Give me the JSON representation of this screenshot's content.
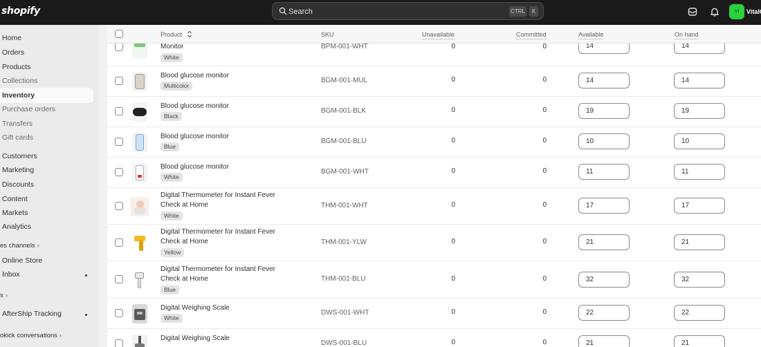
{
  "topbar": {
    "logo": "shopify",
    "search_placeholder": "Search",
    "shortcut_ctrl": "CTRL",
    "shortcut_k": "K",
    "avatar_initials": "VI",
    "store_name": "VitalC"
  },
  "sidebar": {
    "items": [
      {
        "label": "Home"
      },
      {
        "label": "Orders"
      },
      {
        "label": "Products"
      },
      {
        "label": "Collections"
      },
      {
        "label": "Inventory"
      },
      {
        "label": "Purchase orders"
      },
      {
        "label": "Transfers"
      },
      {
        "label": "Gift cards"
      },
      {
        "label": "Customers"
      },
      {
        "label": "Marketing"
      },
      {
        "label": "Discounts"
      },
      {
        "label": "Content"
      },
      {
        "label": "Markets"
      },
      {
        "label": "Analytics"
      },
      {
        "label": "es channels"
      },
      {
        "label": "Online Store"
      },
      {
        "label": "Inbox"
      },
      {
        "label": "s"
      },
      {
        "label": "AfterShip Tracking"
      },
      {
        "label": "okick conversations"
      }
    ]
  },
  "table": {
    "columns": {
      "product": "Product",
      "sku": "SKU",
      "unavailable": "Unavailable",
      "committed": "Committed",
      "available": "Available",
      "on_hand": "On hand"
    },
    "rows": [
      {
        "name": "Monitor",
        "variant": "White",
        "sku": "BPM-001-WHT",
        "unavailable": "0",
        "committed": "0",
        "available": "14",
        "on_hand": "14"
      },
      {
        "name": "Blood glucose monitor",
        "variant": "Multicolor",
        "sku": "BGM-001-MUL",
        "unavailable": "0",
        "committed": "0",
        "available": "14",
        "on_hand": "14"
      },
      {
        "name": "Blood glucose monitor",
        "variant": "Black",
        "sku": "BGM-001-BLK",
        "unavailable": "0",
        "committed": "0",
        "available": "19",
        "on_hand": "19"
      },
      {
        "name": "Blood glucose monitor",
        "variant": "Blue",
        "sku": "BGM-001-BLU",
        "unavailable": "0",
        "committed": "0",
        "available": "10",
        "on_hand": "10"
      },
      {
        "name": "Blood glucose monitor",
        "variant": "White",
        "sku": "BGM-001-WHT",
        "unavailable": "0",
        "committed": "0",
        "available": "11",
        "on_hand": "11"
      },
      {
        "name": "Digital Thermometer for Instant Fever Check at Home",
        "variant": "White",
        "sku": "THM-001-WHT",
        "unavailable": "0",
        "committed": "0",
        "available": "17",
        "on_hand": "17"
      },
      {
        "name": "Digital Thermometer for Instant Fever Check at Home",
        "variant": "Yellow",
        "sku": "THM-001-YLW",
        "unavailable": "0",
        "committed": "0",
        "available": "21",
        "on_hand": "21"
      },
      {
        "name": "Digital Thermometer for Instant Fever Check at Home",
        "variant": "Blue",
        "sku": "THM-001-BLU",
        "unavailable": "0",
        "committed": "0",
        "available": "32",
        "on_hand": "32"
      },
      {
        "name": "Digital Weighing Scale",
        "variant": "White",
        "sku": "DWS-001-WHT",
        "unavailable": "0",
        "committed": "0",
        "available": "22",
        "on_hand": "22"
      },
      {
        "name": "Digital Weighing Scale",
        "variant": "",
        "sku": "DWS-001-BLU",
        "unavailable": "0",
        "committed": "0",
        "available": "21",
        "on_hand": "21"
      }
    ]
  }
}
